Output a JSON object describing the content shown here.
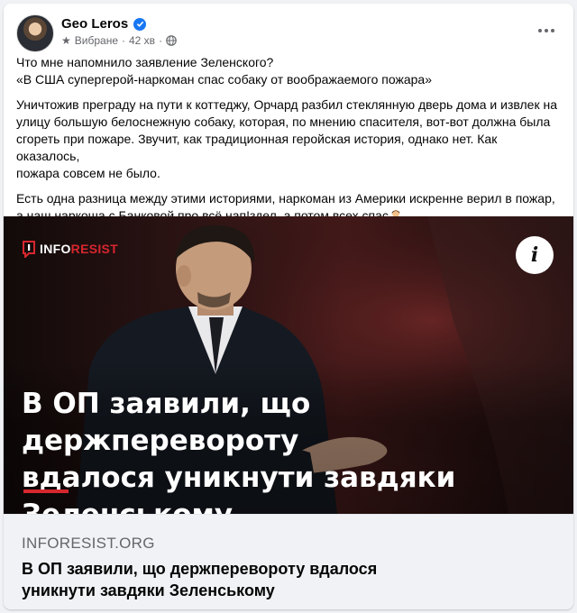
{
  "post": {
    "author": "Geo Leros",
    "audience": "Вибране",
    "time": "42 хв",
    "paragraphs": [
      {
        "lines": [
          "Что мне напомнило заявление Зеленского?",
          "«В США супергерой-наркоман спас собаку от воображаемого пожара»"
        ]
      },
      {
        "lines": [
          "Уничтожив преграду на пути к коттеджу, Орчард разбил стеклянную дверь дома и извлек на",
          "улицу большую белоснежную собаку, которая, по мнению спасителя, вот-вот должна была",
          "сгореть при пожаре. Звучит, как традиционная геройская история, однако нет. Как оказалось,",
          "пожара совсем не было."
        ]
      },
      {
        "lines": [
          "Есть одна разница между этими историями, наркоман из Америки искренне верил в пожар,",
          "а наш наркоша с Банковой про всё нап!здел, а потом всех спас"
        ]
      }
    ],
    "emoji": "man-gesturing-no-emoji"
  },
  "link_preview": {
    "logo_part1": "INFO",
    "logo_part2": "RESIST",
    "headline_lines": [
      "В ОП заявили, що держперевороту",
      "вдалося уникнути завдяки",
      "Зеленському"
    ],
    "domain": "INFORESIST.ORG",
    "title_lines": [
      "В ОП заявили, що держперевороту вдалося",
      "уникнути завдяки Зеленському"
    ]
  },
  "colors": {
    "accent_red": "#d7262e",
    "verified_blue": "#1877f2",
    "secondary_text": "#65676b"
  },
  "icons": [
    "verified-icon",
    "star-icon",
    "globe-icon",
    "more-options-icon",
    "info-icon"
  ]
}
